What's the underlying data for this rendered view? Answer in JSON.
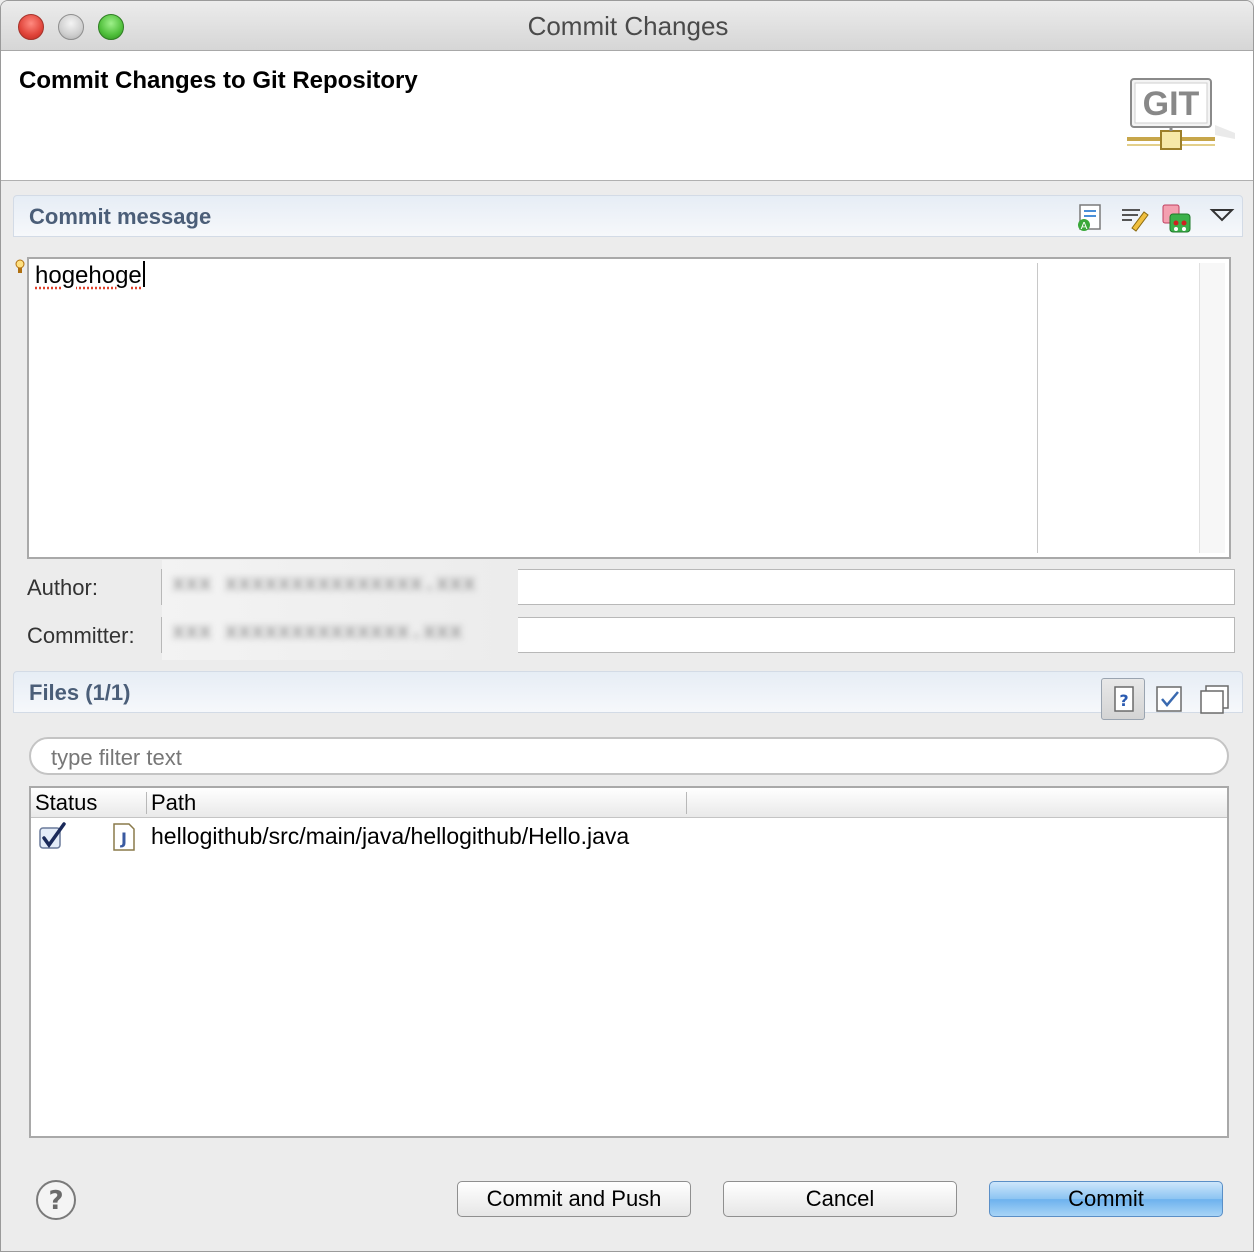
{
  "window": {
    "title": "Commit Changes"
  },
  "banner": {
    "title": "Commit Changes to Git Repository",
    "logo_text": "GIT"
  },
  "commit_message": {
    "section_label": "Commit message",
    "text": "hogehoge",
    "toolbar_icons": [
      "add-signed-off-by-icon",
      "amend-icon",
      "compute-changeid-icon",
      "dropdown-menu-icon"
    ]
  },
  "author": {
    "label": "Author:",
    "value": "xxx xxxxxxxxxxxxxxx.xxx"
  },
  "committer": {
    "label": "Committer:",
    "value": "xxx xxxxxxxxxxxxxx.xxx"
  },
  "files": {
    "section_label": "Files (1/1)",
    "toolbar_icons": [
      "show-untracked-icon",
      "select-all-icon",
      "deselect-all-icon"
    ],
    "filter_placeholder": "type filter text",
    "columns": {
      "status": "Status",
      "path": "Path"
    },
    "rows": [
      {
        "checked": true,
        "icon": "java-file-icon",
        "path": "hellogithub/src/main/java/hellogithub/Hello.java"
      }
    ]
  },
  "buttons": {
    "commit_and_push": "Commit and Push",
    "cancel": "Cancel",
    "commit": "Commit"
  },
  "colors": {
    "primary_button": "#8cc4f2",
    "section_header_text": "#4b5e78",
    "spell_error": "#e0402a"
  }
}
